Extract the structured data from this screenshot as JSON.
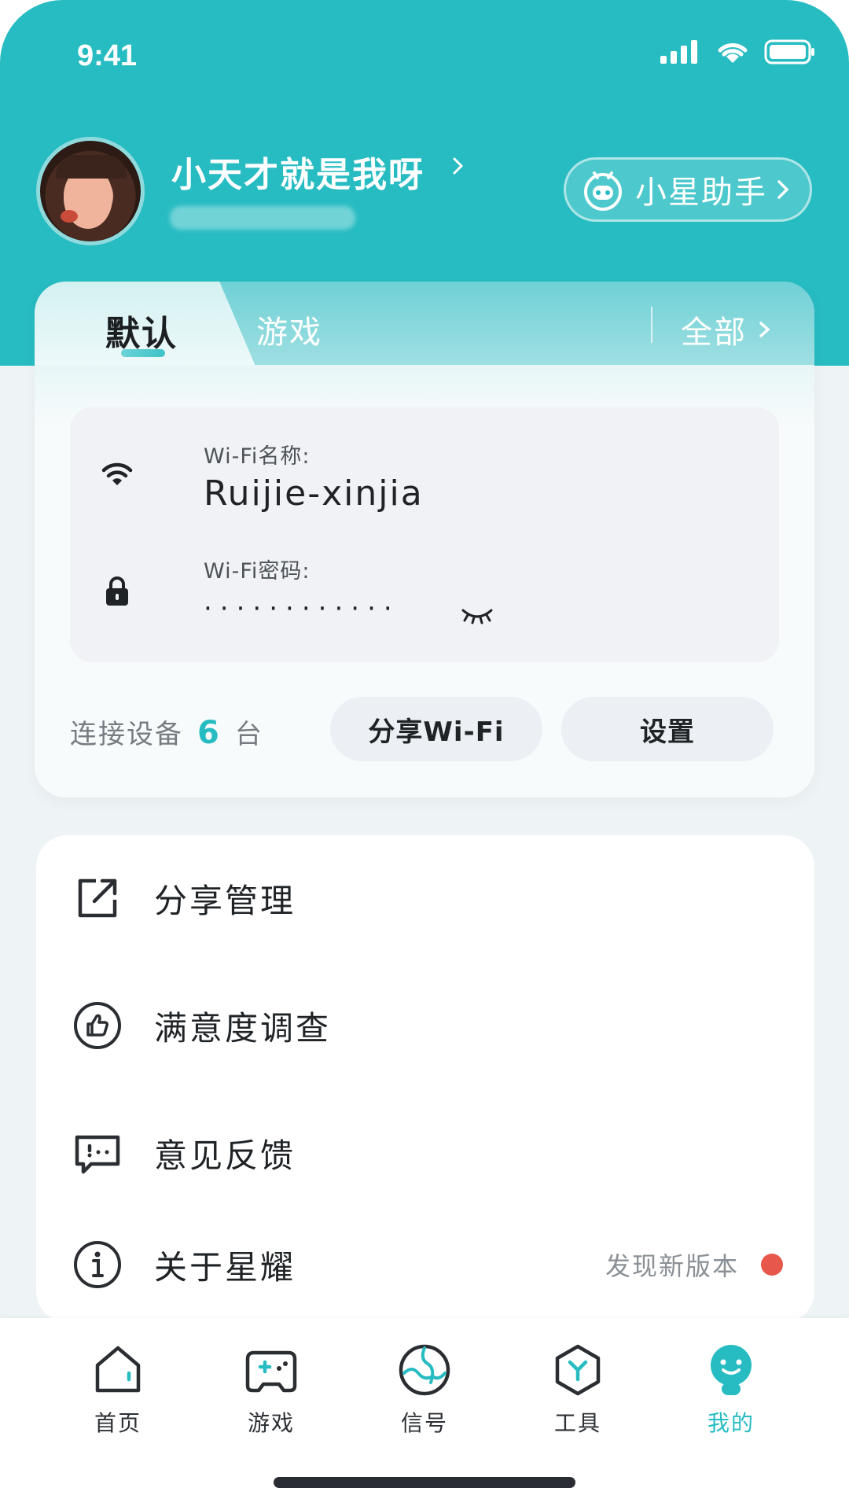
{
  "status_bar": {
    "time": "9:41"
  },
  "profile": {
    "username": "小天才就是我呀"
  },
  "assistant": {
    "label": "小星助手"
  },
  "wifi_card": {
    "tabs": [
      {
        "label": "默认",
        "active": true
      },
      {
        "label": "游戏",
        "active": false
      }
    ],
    "all_label": "全部",
    "name_label": "Wi-Fi名称:",
    "name_value": "Ruijie-xinjia",
    "password_label": "Wi-Fi密码:",
    "password_value": "············",
    "devices_prefix": "连接设备",
    "devices_count": "6",
    "devices_suffix": "台",
    "share_button": "分享Wi-Fi",
    "settings_button": "设置"
  },
  "menu": {
    "items": [
      {
        "label": "分享管理",
        "icon": "share-icon"
      },
      {
        "label": "满意度调查",
        "icon": "thumbs-up-icon"
      },
      {
        "label": "意见反馈",
        "icon": "feedback-icon"
      },
      {
        "label": "关于星耀",
        "icon": "info-icon",
        "hint": "发现新版本",
        "badge_color": "#e8574b"
      }
    ]
  },
  "tabbar": {
    "items": [
      {
        "label": "首页",
        "icon": "home-icon",
        "active": false
      },
      {
        "label": "游戏",
        "icon": "gamepad-icon",
        "active": false
      },
      {
        "label": "信号",
        "icon": "signal-globe-icon",
        "active": false
      },
      {
        "label": "工具",
        "icon": "tools-icon",
        "active": false
      },
      {
        "label": "我的",
        "icon": "profile-smile-icon",
        "active": true
      }
    ]
  },
  "colors": {
    "accent": "#27bcc2",
    "header_bg": "#27bcc2",
    "badge_red": "#e8574b"
  }
}
